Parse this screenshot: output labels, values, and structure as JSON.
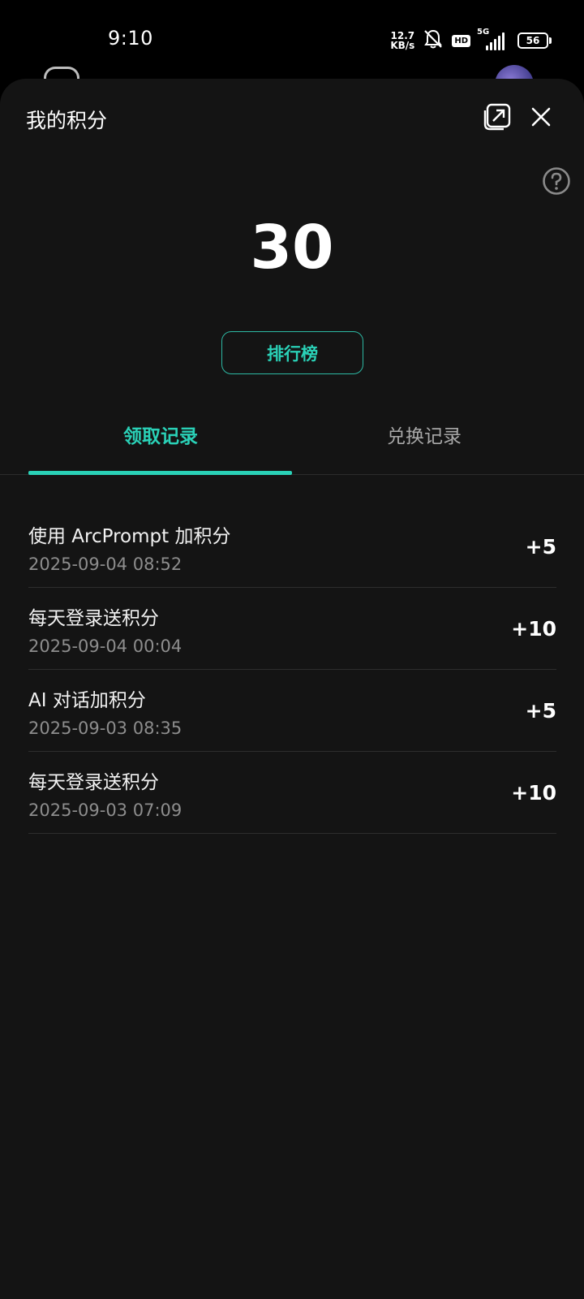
{
  "status_bar": {
    "time": "9:10",
    "net_speed_value": "12.7",
    "net_speed_unit": "KB/s",
    "hd_label": "HD",
    "signal_label": "5G",
    "battery": "56"
  },
  "sheet": {
    "title": "我的积分",
    "points_total": "30",
    "ranking_label": "排行榜"
  },
  "tabs": {
    "active": "领取记录",
    "inactive": "兑换记录"
  },
  "records": [
    {
      "title": "使用 ArcPrompt 加积分",
      "time": "2025-09-04 08:52",
      "points": "+5"
    },
    {
      "title": "每天登录送积分",
      "time": "2025-09-04 00:04",
      "points": "+10"
    },
    {
      "title": "AI 对话加积分",
      "time": "2025-09-03 08:35",
      "points": "+5"
    },
    {
      "title": "每天登录送积分",
      "time": "2025-09-03 07:09",
      "points": "+10"
    }
  ],
  "colors": {
    "accent": "#2ad1b7",
    "sheet_background": "#141414",
    "secondary_text": "#8d8d8d"
  },
  "icons": [
    "mute-bell-icon",
    "open-external-icon",
    "close-icon",
    "help-icon"
  ]
}
